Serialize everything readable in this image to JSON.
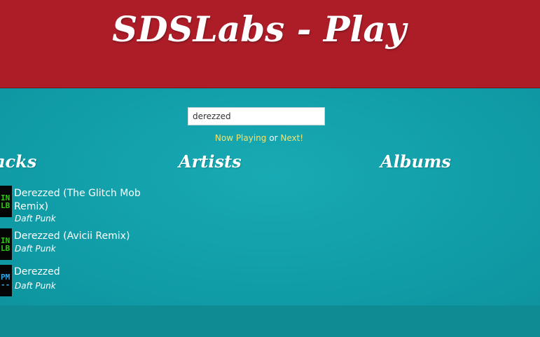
{
  "header": {
    "title": "SDSLabs - Play"
  },
  "search": {
    "value": "derezzed"
  },
  "playlinks": {
    "now_playing": "Now Playing",
    "or": "or",
    "next": "Next!"
  },
  "columns": {
    "tracks": "acks",
    "artists": "Artists",
    "albums": "Albums"
  },
  "tracks": [
    {
      "title": "Derezzed (The Glitch Mob Remix)",
      "artist": "Daft Punk",
      "thumb_color": "#33c81a"
    },
    {
      "title": "Derezzed (Avicii Remix)",
      "artist": "Daft Punk",
      "thumb_color": "#33c81a"
    },
    {
      "title": "Derezzed",
      "artist": "Daft Punk",
      "thumb_color": "#2fa8e8"
    }
  ],
  "colors": {
    "header_red": "#ad1d28",
    "teal_background": "#13a0ab",
    "link_yellow": "#f4e36a"
  }
}
